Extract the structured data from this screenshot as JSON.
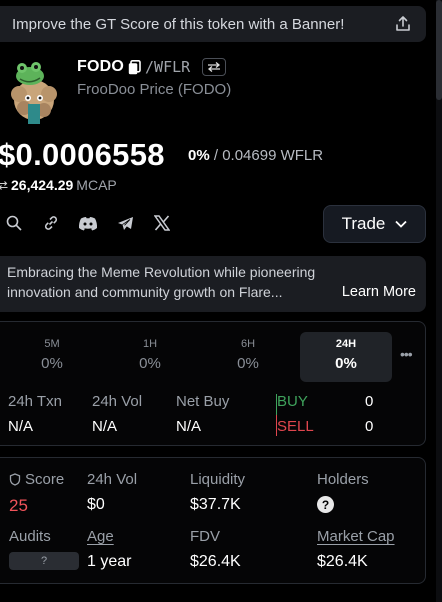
{
  "banner": {
    "text": "Improve the GT Score of this token with a Banner!"
  },
  "token": {
    "symbol": "FODO",
    "pair": "/WFLR",
    "subtitle": "FrooDoo Price (FODO)"
  },
  "price": {
    "value": "$0.0006558",
    "change": "0%",
    "separator": "/",
    "quote": "0.04699 WFLR",
    "mcap_value": "26,424.29",
    "mcap_label": "MCAP"
  },
  "social_icons": [
    "search-icon",
    "link-icon",
    "discord-icon",
    "telegram-icon",
    "x-icon"
  ],
  "trade": {
    "label": "Trade"
  },
  "description": {
    "line1": "Embracing the Meme Revolution while pioneering",
    "line2": "innovation and community growth on Flare...",
    "learn_more": "Learn More"
  },
  "timeframes": [
    {
      "label": "5M",
      "value": "0%"
    },
    {
      "label": "1H",
      "value": "0%"
    },
    {
      "label": "6H",
      "value": "0%"
    },
    {
      "label": "24H",
      "value": "0%",
      "active": true
    }
  ],
  "more_label": "•••",
  "activity": {
    "txn": {
      "label": "24h Txn",
      "value": "N/A"
    },
    "vol": {
      "label": "24h Vol",
      "value": "N/A"
    },
    "net_buy": {
      "label": "Net Buy",
      "value": "N/A"
    },
    "buy": {
      "label": "BUY",
      "value": "0"
    },
    "sell": {
      "label": "SELL",
      "value": "0"
    }
  },
  "metrics": {
    "score": {
      "label": "Score",
      "value": "25"
    },
    "vol": {
      "label": "24h Vol",
      "value": "$0"
    },
    "liquidity": {
      "label": "Liquidity",
      "value": "$37.7K"
    },
    "holders": {
      "label": "Holders",
      "value": "?"
    },
    "audits": {
      "label": "Audits",
      "value": "?"
    },
    "age": {
      "label": "Age",
      "value": "1 year"
    },
    "fdv": {
      "label": "FDV",
      "value": "$26.4K"
    },
    "market_cap": {
      "label": "Market Cap",
      "value": "$26.4K"
    }
  },
  "colors": {
    "buy": "#3fa35c",
    "sell": "#e0464e",
    "score": "#f2545b",
    "panel": "#1b1d22"
  }
}
